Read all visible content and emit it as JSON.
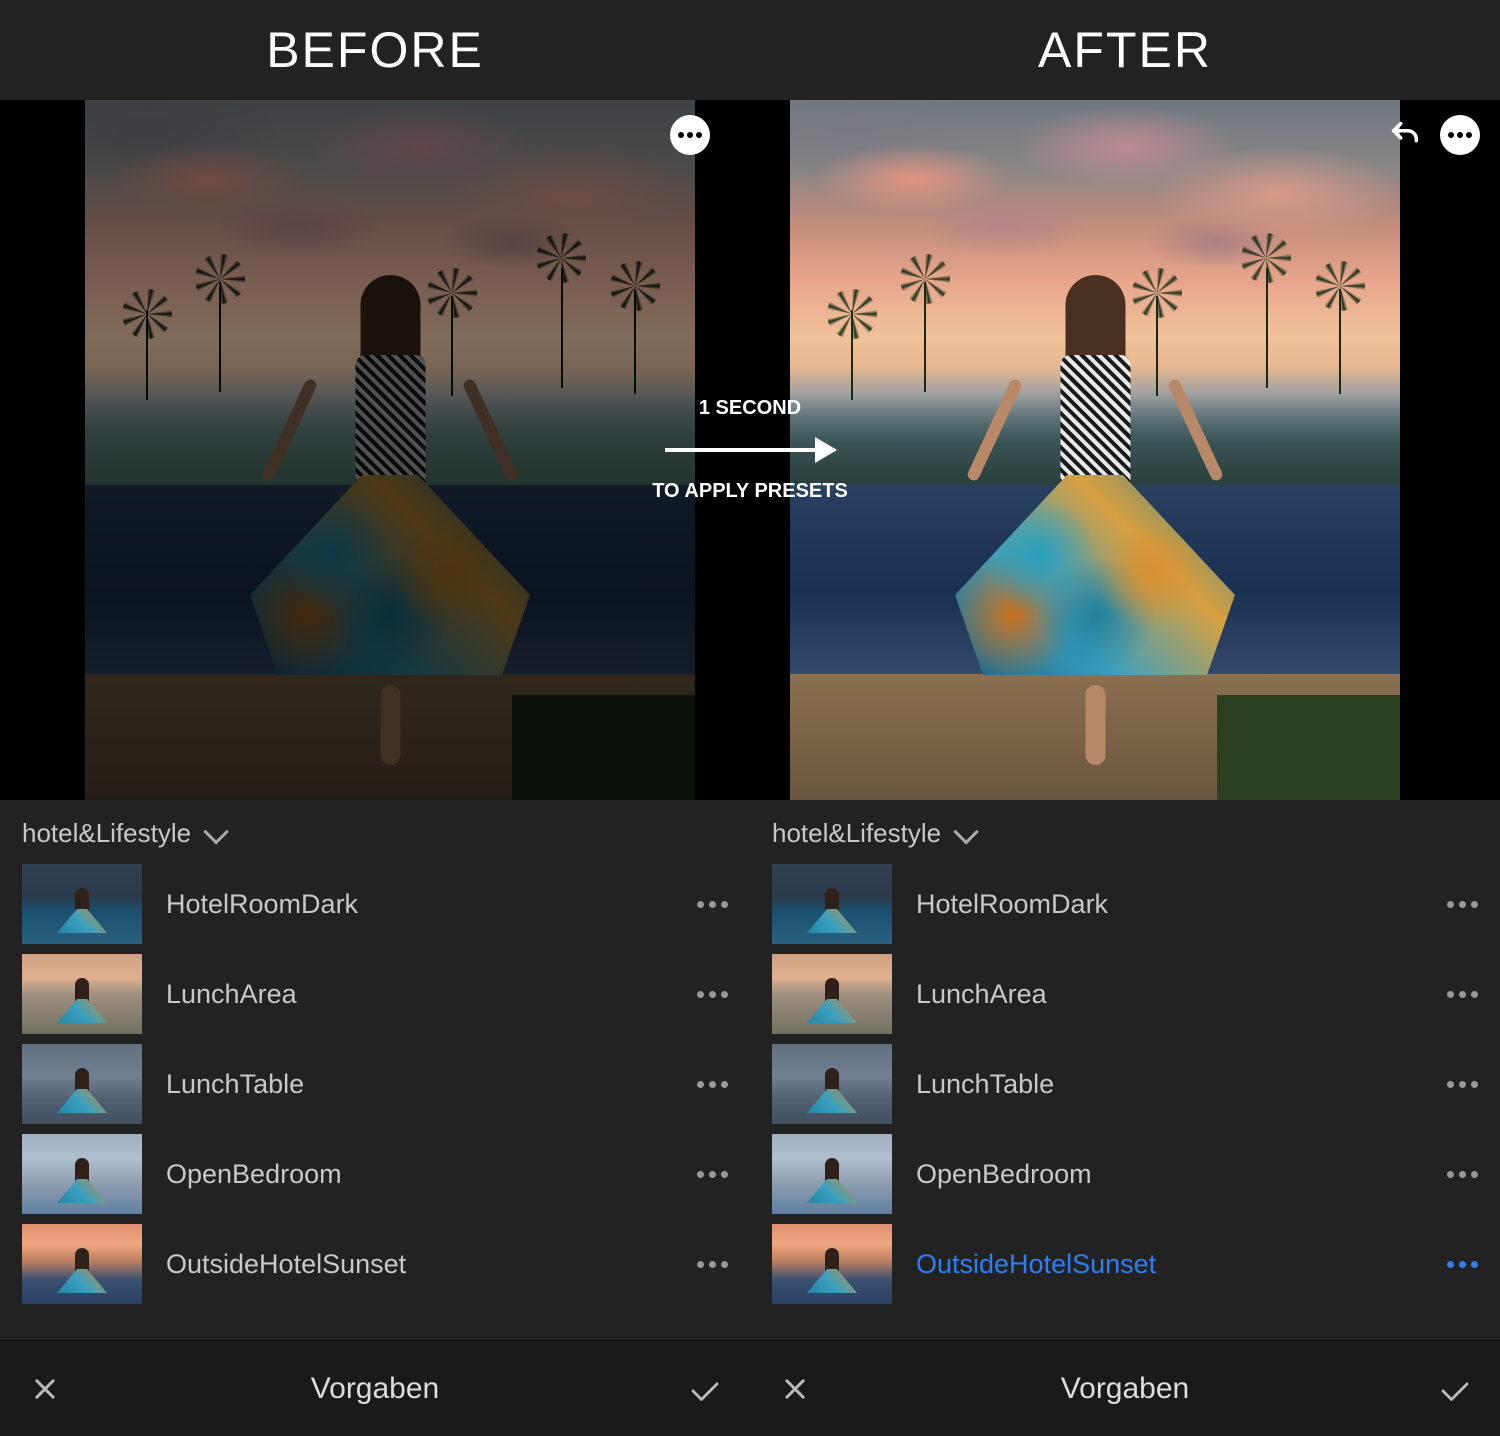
{
  "header": {
    "before": "BEFORE",
    "after": "AFTER"
  },
  "overlay": {
    "line1": "1 SECOND",
    "line2": "TO APPLY PRESETS"
  },
  "panels": {
    "group_name": "hotel&Lifestyle",
    "before": {
      "items": [
        {
          "name": "HotelRoomDark",
          "active": false
        },
        {
          "name": "LunchArea",
          "active": false
        },
        {
          "name": "LunchTable",
          "active": false
        },
        {
          "name": "OpenBedroom",
          "active": false
        },
        {
          "name": "OutsideHotelSunset",
          "active": false
        }
      ]
    },
    "after": {
      "items": [
        {
          "name": "HotelRoomDark",
          "active": false
        },
        {
          "name": "LunchArea",
          "active": false
        },
        {
          "name": "LunchTable",
          "active": false
        },
        {
          "name": "OpenBedroom",
          "active": false
        },
        {
          "name": "OutsideHotelSunset",
          "active": true
        }
      ]
    }
  },
  "footer": {
    "title": "Vorgaben"
  },
  "thumb_styles": [
    "linear-gradient(to bottom,#304050 0%,#2a3a4a 40%,#1a5070 60%,#2a6080 100%)",
    "linear-gradient(to bottom,#d0a080 0%,#e0b090 30%,#a09080 50%,#707060 100%)",
    "linear-gradient(to bottom,#607080 0%,#708090 40%,#506070 70%,#405060 100%)",
    "linear-gradient(to bottom,#a0b0c0 0%,#b0c0d0 30%,#90a0b0 60%,#6080a0 100%)",
    "linear-gradient(to bottom,#e09070 0%,#f0a880 25%,#c08060 45%,#3a5070 70%,#2a4060 100%)"
  ]
}
